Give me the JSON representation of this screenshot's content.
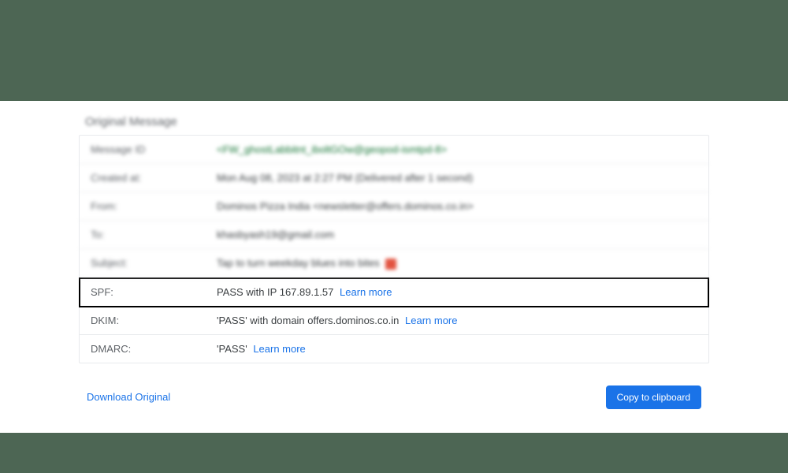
{
  "panel_title": "Original Message",
  "rows": {
    "message_id": {
      "label": "Message ID",
      "value": "<FW_ghostLabbitnt_iboltGOw@geopod-ismtpd-8>"
    },
    "created_at": {
      "label": "Created at:",
      "value": "Mon Aug 08, 2023 at 2:27 PM (Delivered after 1 second)"
    },
    "from": {
      "label": "From:",
      "value": "Dominos Pizza India <newsletter@offers.dominos.co.in>"
    },
    "to": {
      "label": "To:",
      "value": "khasbyash19@gmail.com"
    },
    "subject": {
      "label": "Subject:",
      "value": "Tap to turn weekday blues into bites"
    },
    "spf": {
      "label": "SPF:",
      "value": "PASS with IP 167.89.1.57",
      "learn_more": "Learn more"
    },
    "dkim": {
      "label": "DKIM:",
      "value": "'PASS' with domain offers.dominos.co.in",
      "learn_more": "Learn more"
    },
    "dmarc": {
      "label": "DMARC:",
      "value": "'PASS'",
      "learn_more": "Learn more"
    }
  },
  "actions": {
    "download": "Download Original",
    "copy": "Copy to clipboard"
  }
}
